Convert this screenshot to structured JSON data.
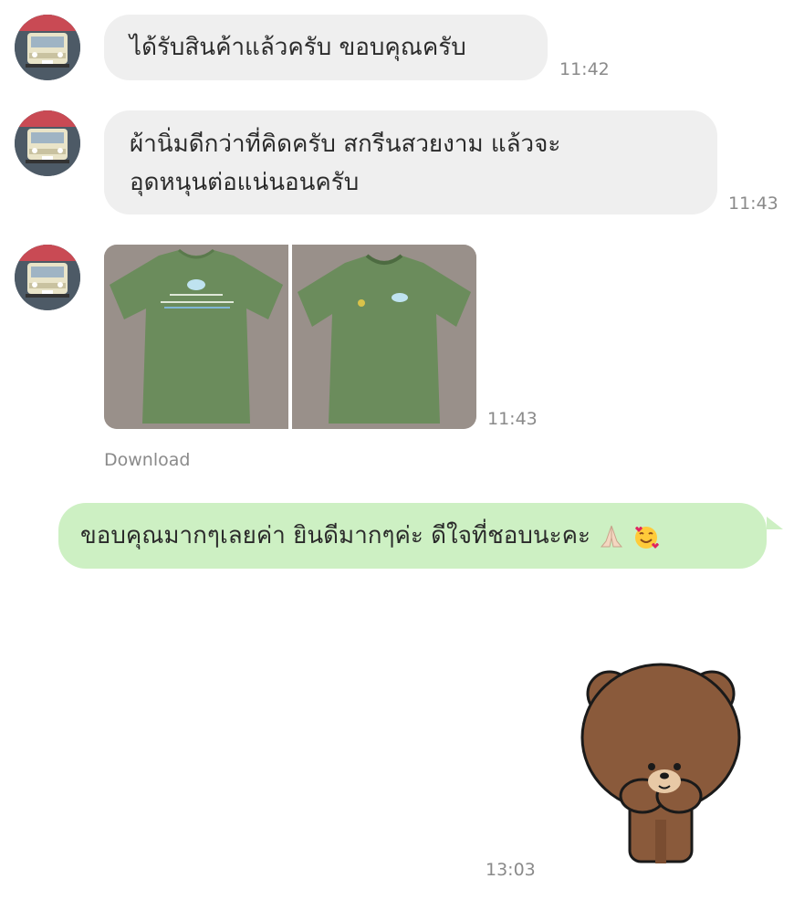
{
  "chat": {
    "messages": [
      {
        "text": "ได้รับสินค้าแล้วครับ ขอบคุณครับ",
        "time": "11:42"
      },
      {
        "line1": "ผ้านิ่มดีกว่าที่คิดครับ สกรีนสวยงาม แล้วจะ",
        "line2": "อุดหนุนต่อแน่นอนครับ",
        "time": "11:43"
      },
      {
        "photos_time": "11:43",
        "download_label": "Download"
      },
      {
        "text": "ขอบคุณมากๆเลยค่า ยินดีมากๆค่ะ ดีใจที่ชอบนะคะ"
      },
      {
        "sticker": "brown-bear-sticker",
        "time": "13:03"
      }
    ]
  },
  "colors": {
    "incoming_bubble": "#efefef",
    "outgoing_bubble": "#cdf0c3",
    "shirt_green": "#6b8c5c",
    "timestamp": "#8a8a8a"
  },
  "icons": [
    "avatar-car-icon",
    "pray-emoji",
    "smiling-hearts-emoji",
    "brown-bear-sticker"
  ]
}
